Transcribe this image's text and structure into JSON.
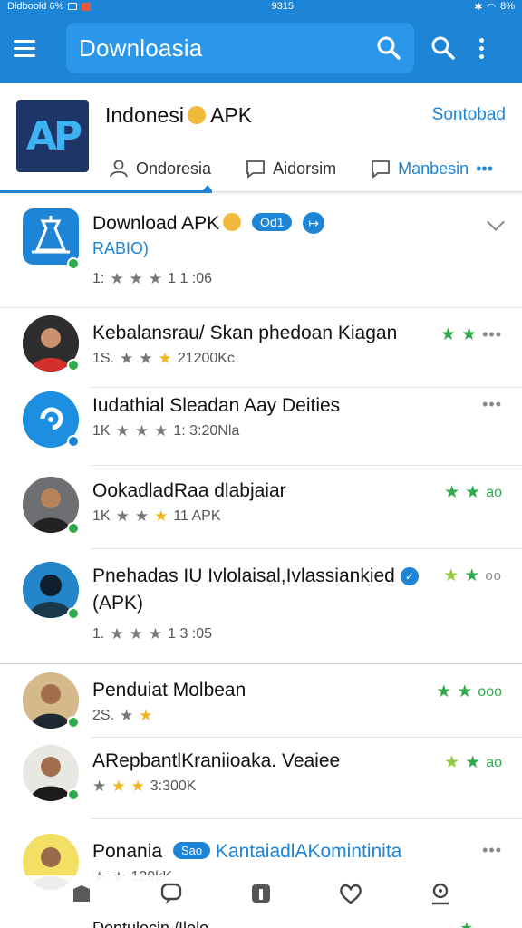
{
  "status_bar": {
    "left_text": "Dldboold 6%",
    "center_time": "9315",
    "right_text": "8%"
  },
  "app_bar": {
    "brand": "Downloasia",
    "icons": [
      "menu-icon",
      "search-icon",
      "search-icon",
      "more-vert-icon"
    ]
  },
  "header": {
    "title": "Indonesi",
    "title_suffix": "APK",
    "action": "Sontobad",
    "tabs": [
      {
        "label": "Ondoresia",
        "icon": "person-icon"
      },
      {
        "label": "Aidorsim",
        "icon": "chat-icon"
      },
      {
        "label": "Manbesin",
        "icon": "chat-icon",
        "more": "•••"
      }
    ]
  },
  "items": [
    {
      "title": "Download APK",
      "pill": "Od1",
      "sub": "RABIO)",
      "meta": "1:",
      "meta_value": "1 1 :06",
      "trail": "chevron"
    },
    {
      "title": "Kebalansrau/ Skan phedoan Kiagan",
      "meta": "1S.",
      "meta_value": "21200Kc",
      "trail_text": "•••"
    },
    {
      "title": "Iudathial Sleadan Aay Deities",
      "meta": "1K",
      "meta_value": "1: 3:20Nla",
      "trail_text": "•••"
    },
    {
      "title": "OokadladRaa dlabjaiar",
      "meta": "1K",
      "meta_value": "11 APK",
      "trail_text": "ao"
    },
    {
      "title": "Pnehadas IU Ivlolaisal,Ivlassiankied",
      "title2": "(APK)",
      "meta": "1.",
      "meta_value": "1 3 :05",
      "trail_text": "oo"
    },
    {
      "title": "Penduiat Molbean",
      "meta": "2S.",
      "meta_value": "",
      "trail_text": "ooo"
    },
    {
      "title": "ARepbantlKraniioaka. Veaiee",
      "meta": "",
      "meta_value": "3:300K",
      "trail_text": "ao"
    },
    {
      "title": "Ponania",
      "pill": "Sao",
      "title_rest": "KantaiadlAKomintinita",
      "meta": "",
      "meta_value": "120kK",
      "trail_text": "•••"
    }
  ],
  "peek_item": {
    "title": "Dontulocin /Ilolo"
  },
  "bottom_nav": [
    "bag-icon",
    "chat-icon",
    "tile-icon",
    "heart-icon",
    "profile-icon"
  ],
  "colors": {
    "primary": "#1d84d6",
    "green": "#2fa94b",
    "gold": "#f1b51c"
  }
}
